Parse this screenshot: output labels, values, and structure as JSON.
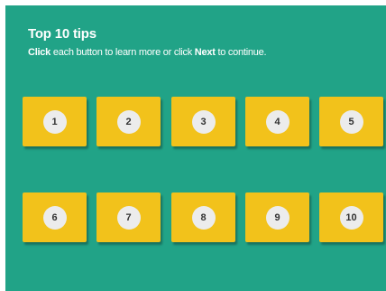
{
  "header": {
    "title": "Top 10 tips",
    "instruction": {
      "click_word": "Click",
      "middle_text": " each button to learn more or click ",
      "next_word": "Next",
      "end_text": " to continue."
    }
  },
  "tips": [
    "1",
    "2",
    "3",
    "4",
    "5",
    "6",
    "7",
    "8",
    "9",
    "10"
  ],
  "colors": {
    "background": "#21a387",
    "button": "#f2c21b",
    "number_circle": "#ececec"
  }
}
